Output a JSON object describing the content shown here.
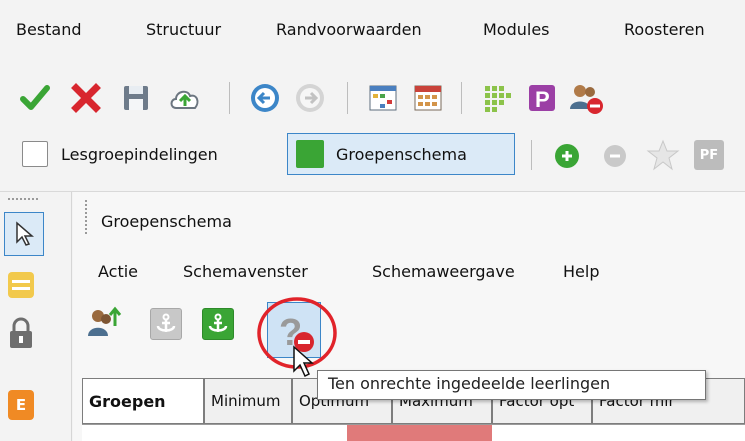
{
  "menubar": {
    "items": [
      "Bestand",
      "Structuur",
      "Randvoorwaarden",
      "Modules",
      "Roosteren"
    ]
  },
  "toolbar": {
    "icons": [
      "check-icon",
      "close-icon",
      "save-icon",
      "cloud-upload-icon",
      "back-arrow-icon",
      "forward-arrow-icon",
      "grid-schedule-icon",
      "calendar-grid-icon",
      "dot-matrix-icon",
      "p-icon",
      "users-remove-icon"
    ]
  },
  "ribbon": {
    "lesgroep_label": "Lesgroepindelingen",
    "groepen_label": "Groepenschema",
    "pr_label": "PF"
  },
  "panel": {
    "title": "Groepenschema",
    "menu": [
      "Actie",
      "Schemavenster",
      "Schemaweergave",
      "Help"
    ]
  },
  "tooltip": {
    "text": "Ten onrechte ingedeelde leerlingen"
  },
  "tabs": [
    "Groepen",
    "Minimum",
    "Optimum",
    "Maximum",
    "Factor opt",
    "Factor mir"
  ],
  "colors": {
    "accent_blue": "#3c86c8",
    "green": "#3aa535",
    "red": "#d8262e",
    "highlight_circle": "#e1232a"
  }
}
